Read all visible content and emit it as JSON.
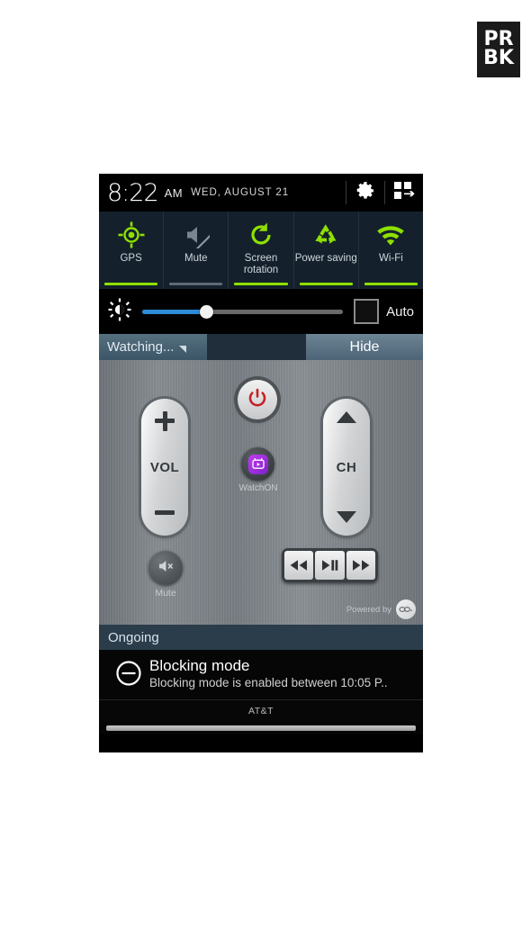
{
  "watermark": {
    "line1": "PR",
    "line2": "BK"
  },
  "statusbar": {
    "time": "8:22",
    "ampm": "AM",
    "date": "WED, AUGUST 21",
    "settings_icon": "gear-icon",
    "quick_settings_icon": "grid-toggle-icon"
  },
  "toggles": [
    {
      "label": "GPS",
      "icon": "gps-icon",
      "state": "on"
    },
    {
      "label": "Mute",
      "icon": "mute-icon",
      "state": "off"
    },
    {
      "label": "Screen rotation",
      "icon": "screen-rotation-icon",
      "state": "on"
    },
    {
      "label": "Power saving",
      "icon": "power-saving-icon",
      "state": "on"
    },
    {
      "label": "Wi-Fi",
      "icon": "wifi-icon",
      "state": "on"
    }
  ],
  "brightness": {
    "icon": "brightness-icon",
    "value_percent": 32,
    "auto_label": "Auto",
    "auto_checked": false,
    "fill_color": "#2e8ad6"
  },
  "watching_bar": {
    "title": "Watching...",
    "dropdown_icon": "triangle-down-icon",
    "hide_label": "Hide"
  },
  "remote": {
    "power_icon": "power-icon",
    "watchon_label": "WatchON",
    "watchon_icon": "watchon-tv-icon",
    "vol_label": "VOL",
    "vol_up_icon": "plus-icon",
    "vol_down_icon": "minus-icon",
    "ch_label": "CH",
    "ch_up_icon": "triangle-up-icon",
    "ch_down_icon": "triangle-down-icon",
    "mute_label": "Mute",
    "mute_icon": "speaker-mute-icon",
    "transport": [
      {
        "name": "rewind",
        "icon": "rewind-icon",
        "glyph": "◀◀"
      },
      {
        "name": "play-pause",
        "icon": "play-pause-icon",
        "glyph": "▶❙❙"
      },
      {
        "name": "fast-forward",
        "icon": "fast-forward-icon",
        "glyph": "▶▶"
      }
    ],
    "powered_by_label": "Powered by",
    "powered_by_logo": "peel-logo"
  },
  "notifications": {
    "section_label": "Ongoing",
    "items": [
      {
        "icon": "blocking-mode-icon",
        "title": "Blocking mode",
        "subtitle": "Blocking mode is enabled between 10:05 P.."
      }
    ]
  },
  "carrier": {
    "name": "AT&T"
  }
}
